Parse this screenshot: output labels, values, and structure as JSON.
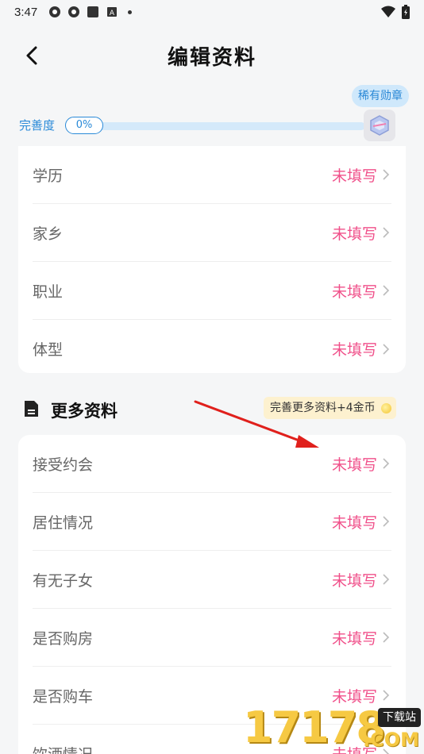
{
  "status_bar": {
    "time": "3:47",
    "icons": [
      "settings-icon",
      "settings-icon",
      "square-app-icon",
      "a-icon",
      "dot-icon"
    ],
    "right_icons": [
      "wifi-icon",
      "battery-icon"
    ]
  },
  "header": {
    "title": "编辑资料"
  },
  "progress": {
    "label": "完善度",
    "percent_text": "0%",
    "value": 0,
    "badge_text": "稀有勋章"
  },
  "basic_rows": [
    {
      "label": "学历",
      "value": "未填写"
    },
    {
      "label": "家乡",
      "value": "未填写"
    },
    {
      "label": "职业",
      "value": "未填写"
    },
    {
      "label": "体型",
      "value": "未填写"
    }
  ],
  "more_section": {
    "title": "更多资料",
    "reward_text": "完善更多资料+4金币"
  },
  "more_rows": [
    {
      "label": "接受约会",
      "value": "未填写"
    },
    {
      "label": "居住情况",
      "value": "未填写"
    },
    {
      "label": "有无子女",
      "value": "未填写"
    },
    {
      "label": "是否购房",
      "value": "未填写"
    },
    {
      "label": "是否购车",
      "value": "未填写"
    },
    {
      "label": "饮酒情况",
      "value": "未填写"
    }
  ],
  "watermark": {
    "digits": "17178",
    "tag": "下载站",
    "suffix": ".COM"
  },
  "colors": {
    "accent_pink": "#f0508a",
    "progress_blue": "#2a8ad8",
    "track": "#d4e9fa"
  }
}
